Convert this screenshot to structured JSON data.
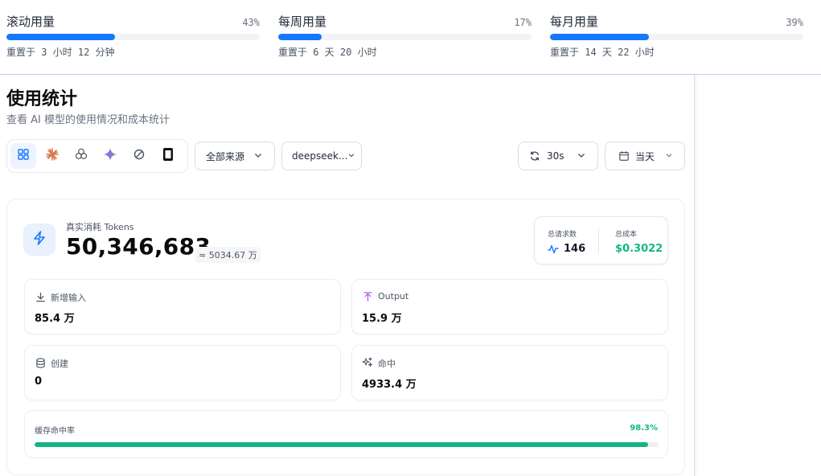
{
  "usage": [
    {
      "title": "滚动用量",
      "percent": 43,
      "percent_label": "43%",
      "reset": "重置于 3 小时 12 分钟"
    },
    {
      "title": "每周用量",
      "percent": 17,
      "percent_label": "17%",
      "reset": "重置于 6 天 20 小时"
    },
    {
      "title": "每月用量",
      "percent": 39,
      "percent_label": "39%",
      "reset": "重置于 14 天 22 小时"
    }
  ],
  "page": {
    "title": "使用统计",
    "subtitle": "查看 AI 模型的使用情况和成本统计"
  },
  "providers": [
    {
      "name": "all-grid-icon",
      "active": true
    },
    {
      "name": "claude-icon",
      "active": false
    },
    {
      "name": "openai-icon",
      "active": false
    },
    {
      "name": "gemini-icon",
      "active": false
    },
    {
      "name": "refresh-model-icon",
      "active": false
    },
    {
      "name": "device-icon",
      "active": false
    }
  ],
  "filters": {
    "source": "全部来源",
    "model": "deepseek...",
    "refresh": "30s",
    "date": "当天"
  },
  "stats": {
    "tokens_label": "真实消耗 Tokens",
    "tokens_value": "50,346,683",
    "tokens_approx": "≈ 5034.67 万",
    "requests_label": "总请求数",
    "requests_value": "146",
    "cost_label": "总成本",
    "cost_value": "$0.3022",
    "metrics": {
      "input": {
        "label": "新增输入",
        "value": "85.4 万"
      },
      "output": {
        "label": "Output",
        "value": "15.9 万"
      },
      "create": {
        "label": "创建",
        "value": "0"
      },
      "hit": {
        "label": "命中",
        "value": "4933.4 万"
      }
    },
    "cache_label": "缓存命中率",
    "cache_percent": 98.3,
    "cache_percent_label": "98.3%"
  },
  "colors": {
    "accent": "#1677ff",
    "success": "#10b981",
    "cache_bar": "#16b384"
  }
}
